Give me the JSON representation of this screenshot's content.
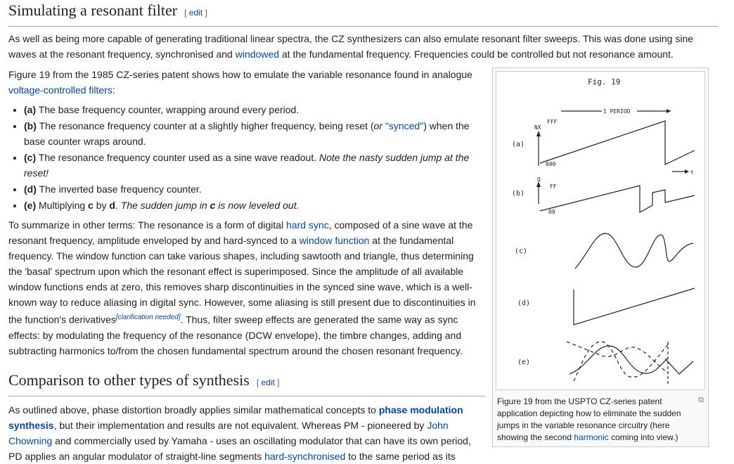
{
  "section1": {
    "heading": "Simulating a resonant filter",
    "edit": "edit",
    "intro_a": "As well as being more capable of generating traditional linear spectra, the CZ synthesizers can also emulate resonant filter sweeps. This was done using sine waves at the resonant frequency, synchronised and ",
    "intro_link": "windowed",
    "intro_b": " at the fundamental frequency. Frequencies could be controlled but not resonance amount.",
    "p2_a": "Figure 19 from the 1985 CZ-series patent shows how to emulate the variable resonance found in analogue ",
    "p2_link": "voltage-controlled filters",
    "p2_b": ":",
    "items": [
      {
        "key": "(a)",
        "text": " The base frequency counter, wrapping around every period."
      },
      {
        "key": "(b)",
        "text_a": " The resonance frequency counter at a slightly higher frequency, being reset (",
        "italic_a": "or ",
        "link": "\"synced\"",
        "text_b": ") when the base counter wraps around."
      },
      {
        "key": "(c)",
        "text": " The resonance frequency counter used as a sine wave readout. ",
        "italic": "Note the nasty sudden jump at the reset!"
      },
      {
        "key": "(d)",
        "text": " The inverted base frequency counter."
      },
      {
        "key": "(e)",
        "text_a": " Multiplying ",
        "b1": "c",
        "text_b": " by ",
        "b2": "d",
        "text_c": ". ",
        "italic_a": "The sudden jump in ",
        "b3": "c",
        "italic_b": " is now leveled out."
      }
    ],
    "p3": {
      "t1": "To summarize in other terms: The resonance is a form of digital ",
      "l1": "hard sync",
      "t2": ", composed of a sine wave at the resonant frequency, amplitude enveloped by and hard-synced to a ",
      "l2": "window function",
      "t3": " at the fundamental frequency. The window function can take various shapes, including sawtooth and triangle, thus determining the 'basal' spectrum upon which the resonant effect is superimposed. Since the amplitude of all available window functions ends at zero, this removes sharp discontinuities in the synced sine wave, which is a well-known way to reduce aliasing in digital sync. However, some aliasing is still present due to discontinuities in the function's derivatives",
      "sup": "[clarification needed]",
      "t4": ". Thus, filter sweep effects are generated the same way as sync effects: by modulating the frequency of the resonance (DCW envelope), the timbre changes, adding and subtracting harmonics to/from the chosen fundamental spectrum around the chosen resonant frequency."
    }
  },
  "figure": {
    "title": "Fig. 19",
    "period": "1 PERIOD",
    "labels": [
      "(a)",
      "(b)",
      "(c)",
      "(d)",
      "(e)"
    ],
    "nx": "NX",
    "fff": "FFF",
    "zero3": "000",
    "q": "Q",
    "ff": "FF",
    "zero2": "00",
    "t": "t",
    "caption_a": "Figure 19 from the USPTO CZ-series patent application depicting how to eliminate the sudden jumps in the variable resonance circuitry (here showing the second ",
    "caption_link": "harmonic",
    "caption_b": " coming into view.)"
  },
  "section2": {
    "heading": "Comparison to other types of synthesis",
    "edit": "edit",
    "t1": "As outlined above, phase distortion broadly applies similar mathematical concepts to ",
    "l1": "phase modulation synthesis",
    "t2": ", but their implementation and results are not equivalent. Whereas PM - pioneered by ",
    "l2": "John Chowning",
    "t3": " and commercially used by Yamaha - uses an oscillating modulator that can have its own period, PD applies an angular modulator of straight-line segments ",
    "l3": "hard-synchronised",
    "t4": " to the same period as its"
  }
}
